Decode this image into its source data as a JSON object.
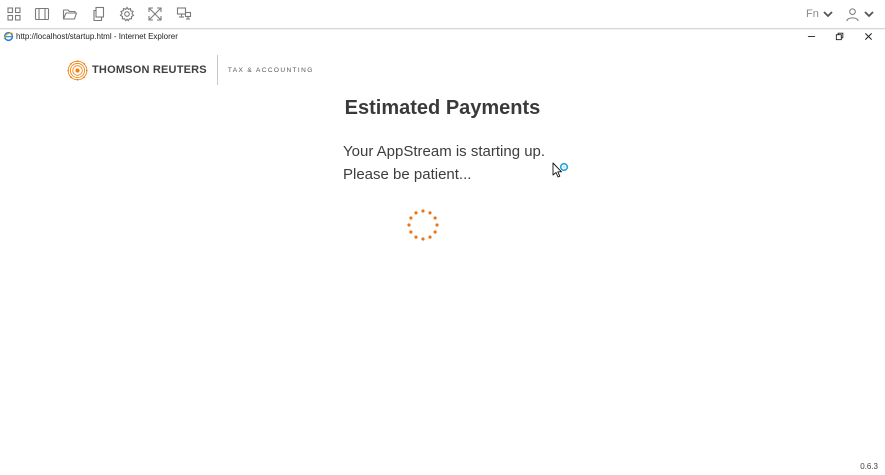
{
  "toolbar": {
    "buttons": [
      {
        "name": "catalog-icon"
      },
      {
        "name": "desktop-view-icon"
      },
      {
        "name": "folder-icon"
      },
      {
        "name": "clipboard-icon"
      },
      {
        "name": "settings-icon"
      },
      {
        "name": "fullscreen-icon"
      },
      {
        "name": "multiple-displays-icon"
      }
    ],
    "keyboard_label": "Fn",
    "user_icon": "user-icon"
  },
  "window": {
    "title": "http://localhost/startup.html - Internet Explorer",
    "icon": "internet-explorer-icon"
  },
  "page": {
    "logo": {
      "company": "THOMSON REUTERS",
      "division": "TAX & ACCOUNTING",
      "brand_color": "#f07f0b"
    },
    "heading": "Estimated Payments",
    "message_line1": "Your AppStream is starting up.",
    "message_line2": "Please be patient...",
    "spinner": {
      "icon": "loading-spinner-icon",
      "color": "#e8771a"
    },
    "version": "0.6.3"
  }
}
